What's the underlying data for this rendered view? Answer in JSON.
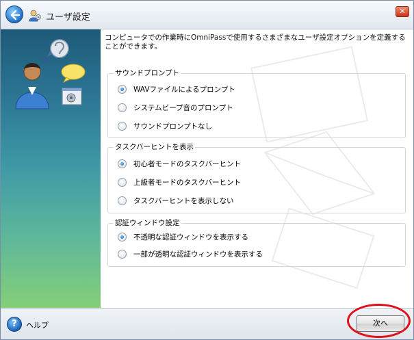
{
  "window": {
    "title": "ユーザ設定"
  },
  "description": "コンピュータでの作業時にOmniPassで使用するさまざまなユーザ設定オプションを定義することができます。",
  "groups": [
    {
      "title": "サウンドプロンプト",
      "options": [
        {
          "label": "WAVファイルによるプロンプト",
          "selected": true
        },
        {
          "label": "システムビープ音のプロンプト",
          "selected": false
        },
        {
          "label": "サウンドプロンプトなし",
          "selected": false
        }
      ]
    },
    {
      "title": "タスクバーヒントを表示",
      "options": [
        {
          "label": "初心者モードのタスクバーヒント",
          "selected": true
        },
        {
          "label": "上級者モードのタスクバーヒント",
          "selected": false
        },
        {
          "label": "タスクバーヒントを表示しない",
          "selected": false
        }
      ]
    },
    {
      "title": "認証ウィンドウ設定",
      "options": [
        {
          "label": "不透明な認証ウィンドウを表示する",
          "selected": true
        },
        {
          "label": "一部が透明な認証ウィンドウを表示する",
          "selected": false
        }
      ]
    }
  ],
  "footer": {
    "help_label": "ヘルプ",
    "next_label": "次へ"
  },
  "icons": {
    "back": "back-arrow-icon",
    "app": "user-settings-icon",
    "close": "close-icon",
    "help": "help-icon"
  },
  "colors": {
    "close": "#c8341a",
    "highlight": "#e0101a"
  }
}
